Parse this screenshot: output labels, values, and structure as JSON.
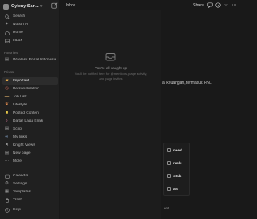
{
  "workspace": {
    "name": "Gyleny Sari..."
  },
  "sidebar": {
    "top_items": [
      {
        "label": "Search",
        "icon": "search-icon"
      },
      {
        "label": "Notion AI",
        "icon": "sparkle-icon"
      },
      {
        "label": "Home",
        "icon": "home-icon"
      },
      {
        "label": "Inbox",
        "icon": "inbox-icon"
      }
    ],
    "favorites_title": "Favorites",
    "favorites": [
      {
        "label": "Wireless Portal Indonesia"
      }
    ],
    "private_title": "Private",
    "private": [
      {
        "label": "Important"
      },
      {
        "label": "Personalisation"
      },
      {
        "label": "Job List"
      },
      {
        "label": "Lifestyle"
      },
      {
        "label": "Posted Content"
      },
      {
        "label": "Daftar Lagu Enak"
      },
      {
        "label": "Script"
      },
      {
        "label": "My links"
      },
      {
        "label": "Knight Views"
      },
      {
        "label": "New page"
      },
      {
        "label": "More"
      }
    ],
    "bottom_items": [
      {
        "label": "Calendar"
      },
      {
        "label": "Settings"
      },
      {
        "label": "Templates"
      },
      {
        "label": "Trash"
      },
      {
        "label": "Help"
      }
    ]
  },
  "topbar": {
    "breadcrumb": "Inbox",
    "share_label": "Share"
  },
  "inbox": {
    "empty_title": "You're all caught up",
    "empty_desc": "You'll be notified here for @mentions, page activity, and page invites"
  },
  "document": {
    "text_line": "ai keuangan, termasuk PNL",
    "tags": [
      "need",
      "rack",
      "stab",
      "art"
    ],
    "footer_fragment": "ent"
  },
  "colors": {
    "background": "#191919",
    "sidebar": "#202020",
    "text": "#d4d4d4"
  }
}
